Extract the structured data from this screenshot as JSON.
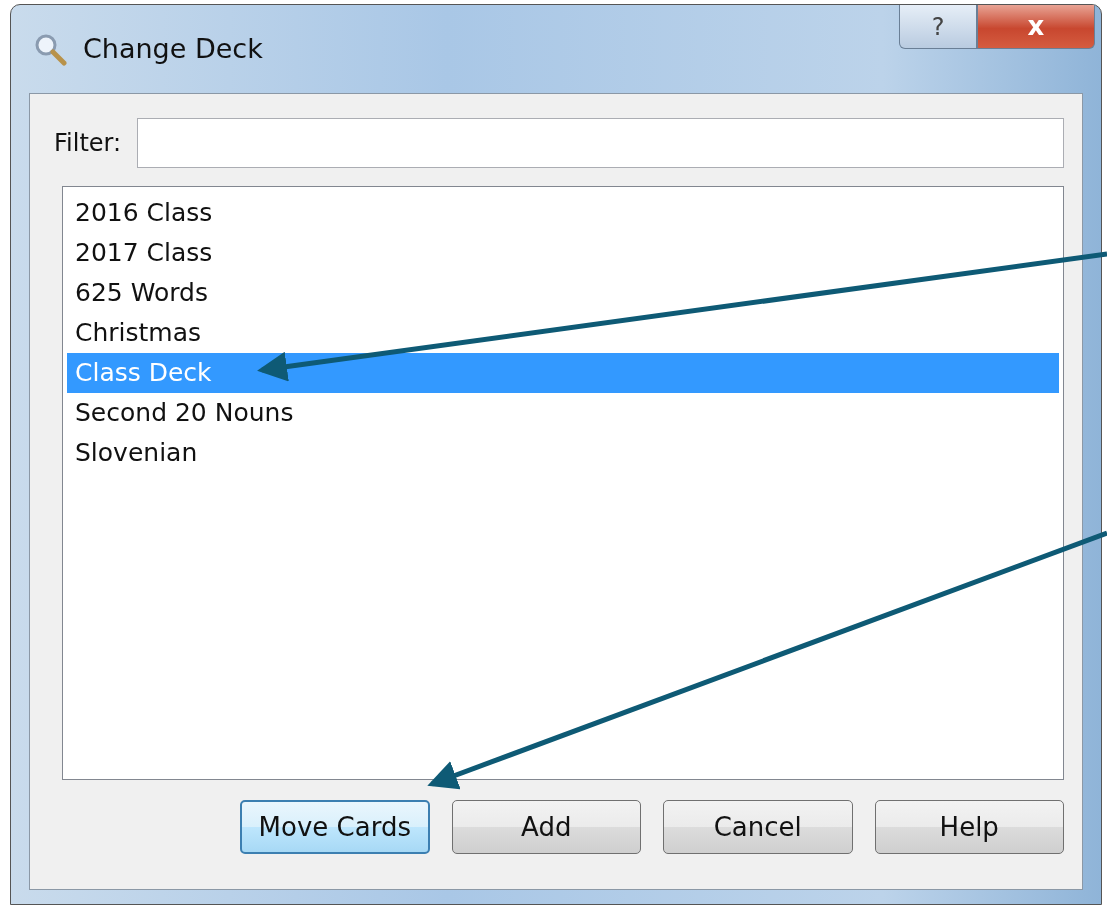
{
  "window": {
    "title": "Change Deck",
    "caption_buttons": [
      "?",
      "x"
    ]
  },
  "filter": {
    "label": "Filter:"
  },
  "decks": [
    {
      "name": "2016 Class",
      "selected": false
    },
    {
      "name": "2017 Class",
      "selected": false
    },
    {
      "name": "625 Words",
      "selected": false
    },
    {
      "name": "Christmas",
      "selected": false
    },
    {
      "name": "Class Deck",
      "selected": true
    },
    {
      "name": "Second 20 Nouns",
      "selected": false
    },
    {
      "name": "Slovenian",
      "selected": false
    }
  ],
  "buttons": [
    {
      "label": "Move Cards",
      "default": true
    },
    {
      "label": "Add",
      "default": false
    },
    {
      "label": "Cancel",
      "default": false
    },
    {
      "label": "Help",
      "default": false
    }
  ]
}
